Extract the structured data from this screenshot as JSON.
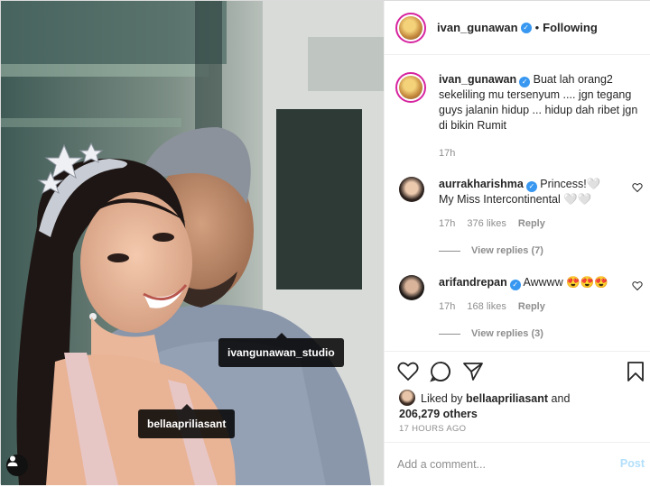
{
  "post": {
    "photo_tags": {
      "studio": "ivangunawan_studio",
      "bella": "bellaapriliasant"
    },
    "user_tags_icon": "person-icon"
  },
  "header": {
    "username": "ivan_gunawan",
    "separator": "•",
    "follow_status": "Following",
    "verified_icon": "verified-badge-icon"
  },
  "caption": {
    "username": "ivan_gunawan",
    "text": "Buat lah orang2 sekeliling mu tersenyum .... jgn tegang guys jalanin hidup ... hidup dah ribet jgn di bikin Rumit",
    "time": "17h"
  },
  "comments": [
    {
      "username": "aurrakharishma",
      "text": "Princess!🤍 My Miss Intercontinental 🤍🤍",
      "time": "17h",
      "likes": "376 likes",
      "reply_label": "Reply",
      "view_replies": "View replies (7)"
    },
    {
      "username": "arifandrepan",
      "text": "Awwww 😍😍😍",
      "time": "17h",
      "likes": "168 likes",
      "reply_label": "Reply",
      "view_replies": "View replies (3)"
    }
  ],
  "actions": {
    "icons": [
      "heart-icon",
      "comment-icon",
      "share-icon",
      "bookmark-icon"
    ],
    "liked_prefix": "Liked by",
    "liked_user": "bellaapriliasant",
    "liked_and": "and",
    "liked_others": "206,279 others",
    "timestamp": "17 HOURS AGO"
  },
  "add_comment": {
    "placeholder": "Add a comment...",
    "post_label": "Post"
  },
  "colors": {
    "verified": "#3897f0",
    "story_ring": "#d6249f",
    "post_disabled": "#b2dffc",
    "muted_text": "#8e8e8e"
  }
}
